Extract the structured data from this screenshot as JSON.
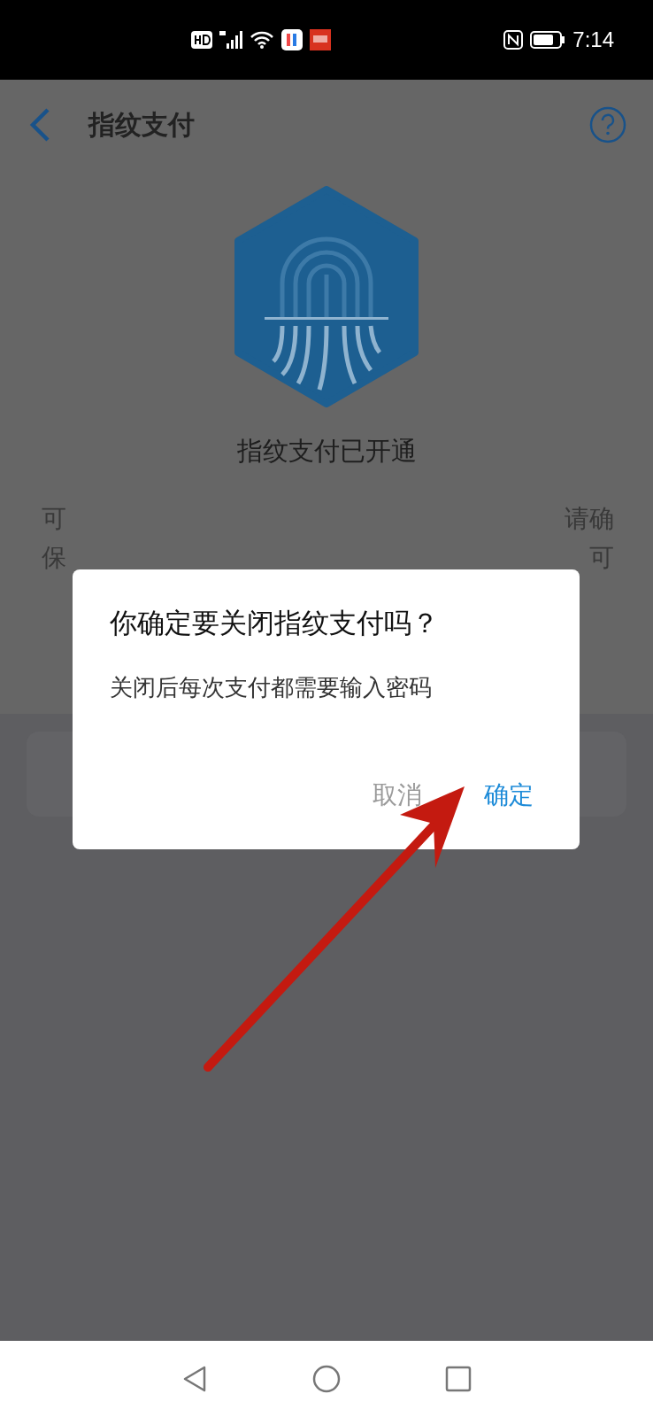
{
  "status_bar": {
    "time": "7:14"
  },
  "header": {
    "title": "指纹支付"
  },
  "page": {
    "status_text": "指纹支付已开通",
    "description_lines": [
      {
        "left": "可",
        "right": "请确"
      },
      {
        "left": "保",
        "right": "可"
      }
    ]
  },
  "dialog": {
    "title": "你确定要关闭指纹支付吗？",
    "message": "关闭后每次支付都需要输入密码",
    "buttons": [
      {
        "label": "取消",
        "kind": "secondary"
      },
      {
        "label": "确定",
        "kind": "primary"
      }
    ]
  }
}
